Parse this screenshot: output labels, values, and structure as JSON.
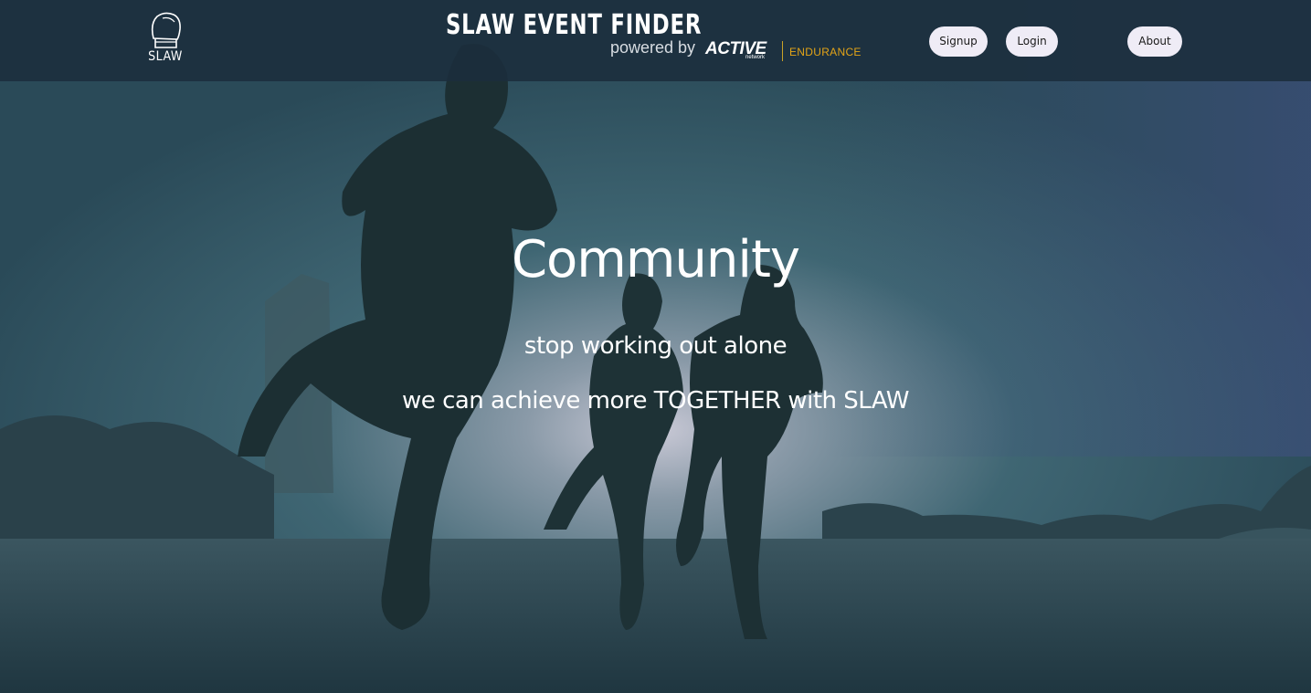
{
  "header": {
    "logo_text": "SLAW",
    "brand_title": "SLAW EVENT FINDER",
    "brand_powered": "powered by",
    "brand_partner": "ACTIVE",
    "brand_partner_sub": "network",
    "brand_partner_division": "ENDURANCE",
    "nav": {
      "signup": "Signup",
      "login": "Login",
      "about": "About"
    }
  },
  "hero": {
    "title": "Community",
    "line1": "stop working out alone",
    "line2": "we can achieve more TOGETHER with SLAW"
  },
  "colors": {
    "header_bg": "#1b2d3c",
    "button_bg": "#efecf6",
    "accent_endurance": "#e3a417",
    "hero_tint": "#2b4a55"
  }
}
